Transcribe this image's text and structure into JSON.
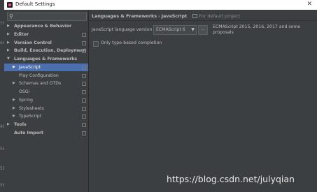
{
  "window": {
    "title": "Default Settings",
    "close_glyph": "✕"
  },
  "sidebar": {
    "search_icon": "search-icon",
    "items": [
      {
        "label": "Appearance & Behavior",
        "bold": true,
        "arrow": "▶",
        "indent": 0
      },
      {
        "label": "Editor",
        "bold": true,
        "arrow": "▶",
        "indent": 0
      },
      {
        "label": "Version Control",
        "bold": true,
        "arrow": "▶",
        "indent": 0
      },
      {
        "label": "Build, Execution, Deployment",
        "bold": true,
        "arrow": "▶",
        "indent": 0
      },
      {
        "label": "Languages & Frameworks",
        "bold": true,
        "arrow": "▼",
        "indent": 0
      },
      {
        "label": "JavaScript",
        "bold": false,
        "arrow": "▶",
        "indent": 1,
        "selected": true
      },
      {
        "label": "Play Configuration",
        "bold": false,
        "arrow": "",
        "indent": 1
      },
      {
        "label": "Schemas and DTDs",
        "bold": false,
        "arrow": "▶",
        "indent": 1
      },
      {
        "label": "OSGi",
        "bold": false,
        "arrow": "",
        "indent": 1
      },
      {
        "label": "Spring",
        "bold": false,
        "arrow": "▶",
        "indent": 1
      },
      {
        "label": "Stylesheets",
        "bold": false,
        "arrow": "▶",
        "indent": 1
      },
      {
        "label": "TypeScript",
        "bold": false,
        "arrow": "▶",
        "indent": 1
      },
      {
        "label": "Tools",
        "bold": true,
        "arrow": "▶",
        "indent": 0
      },
      {
        "label": "Auto Import",
        "bold": true,
        "arrow": "",
        "indent": 0
      }
    ]
  },
  "content": {
    "breadcrumb": {
      "parent": "Languages & Frameworks",
      "separator": "›",
      "current": "JavaScript",
      "scope": "For default project"
    },
    "language_version": {
      "label": "JavaScript language version",
      "selected": "ECMAScript 6",
      "dropdown_glyph": "▼",
      "more_button": "...",
      "description": "ECMAScript 2015, 2016, 2017 and some proposals"
    },
    "type_based_completion": {
      "label": "Only type-based completion",
      "checked": false
    }
  },
  "watermark": "https://blog.csdn.net/julyqian",
  "colors": {
    "selection": "#4b6eaf",
    "panel": "#3c3f41",
    "text": "#bbbbbb"
  }
}
